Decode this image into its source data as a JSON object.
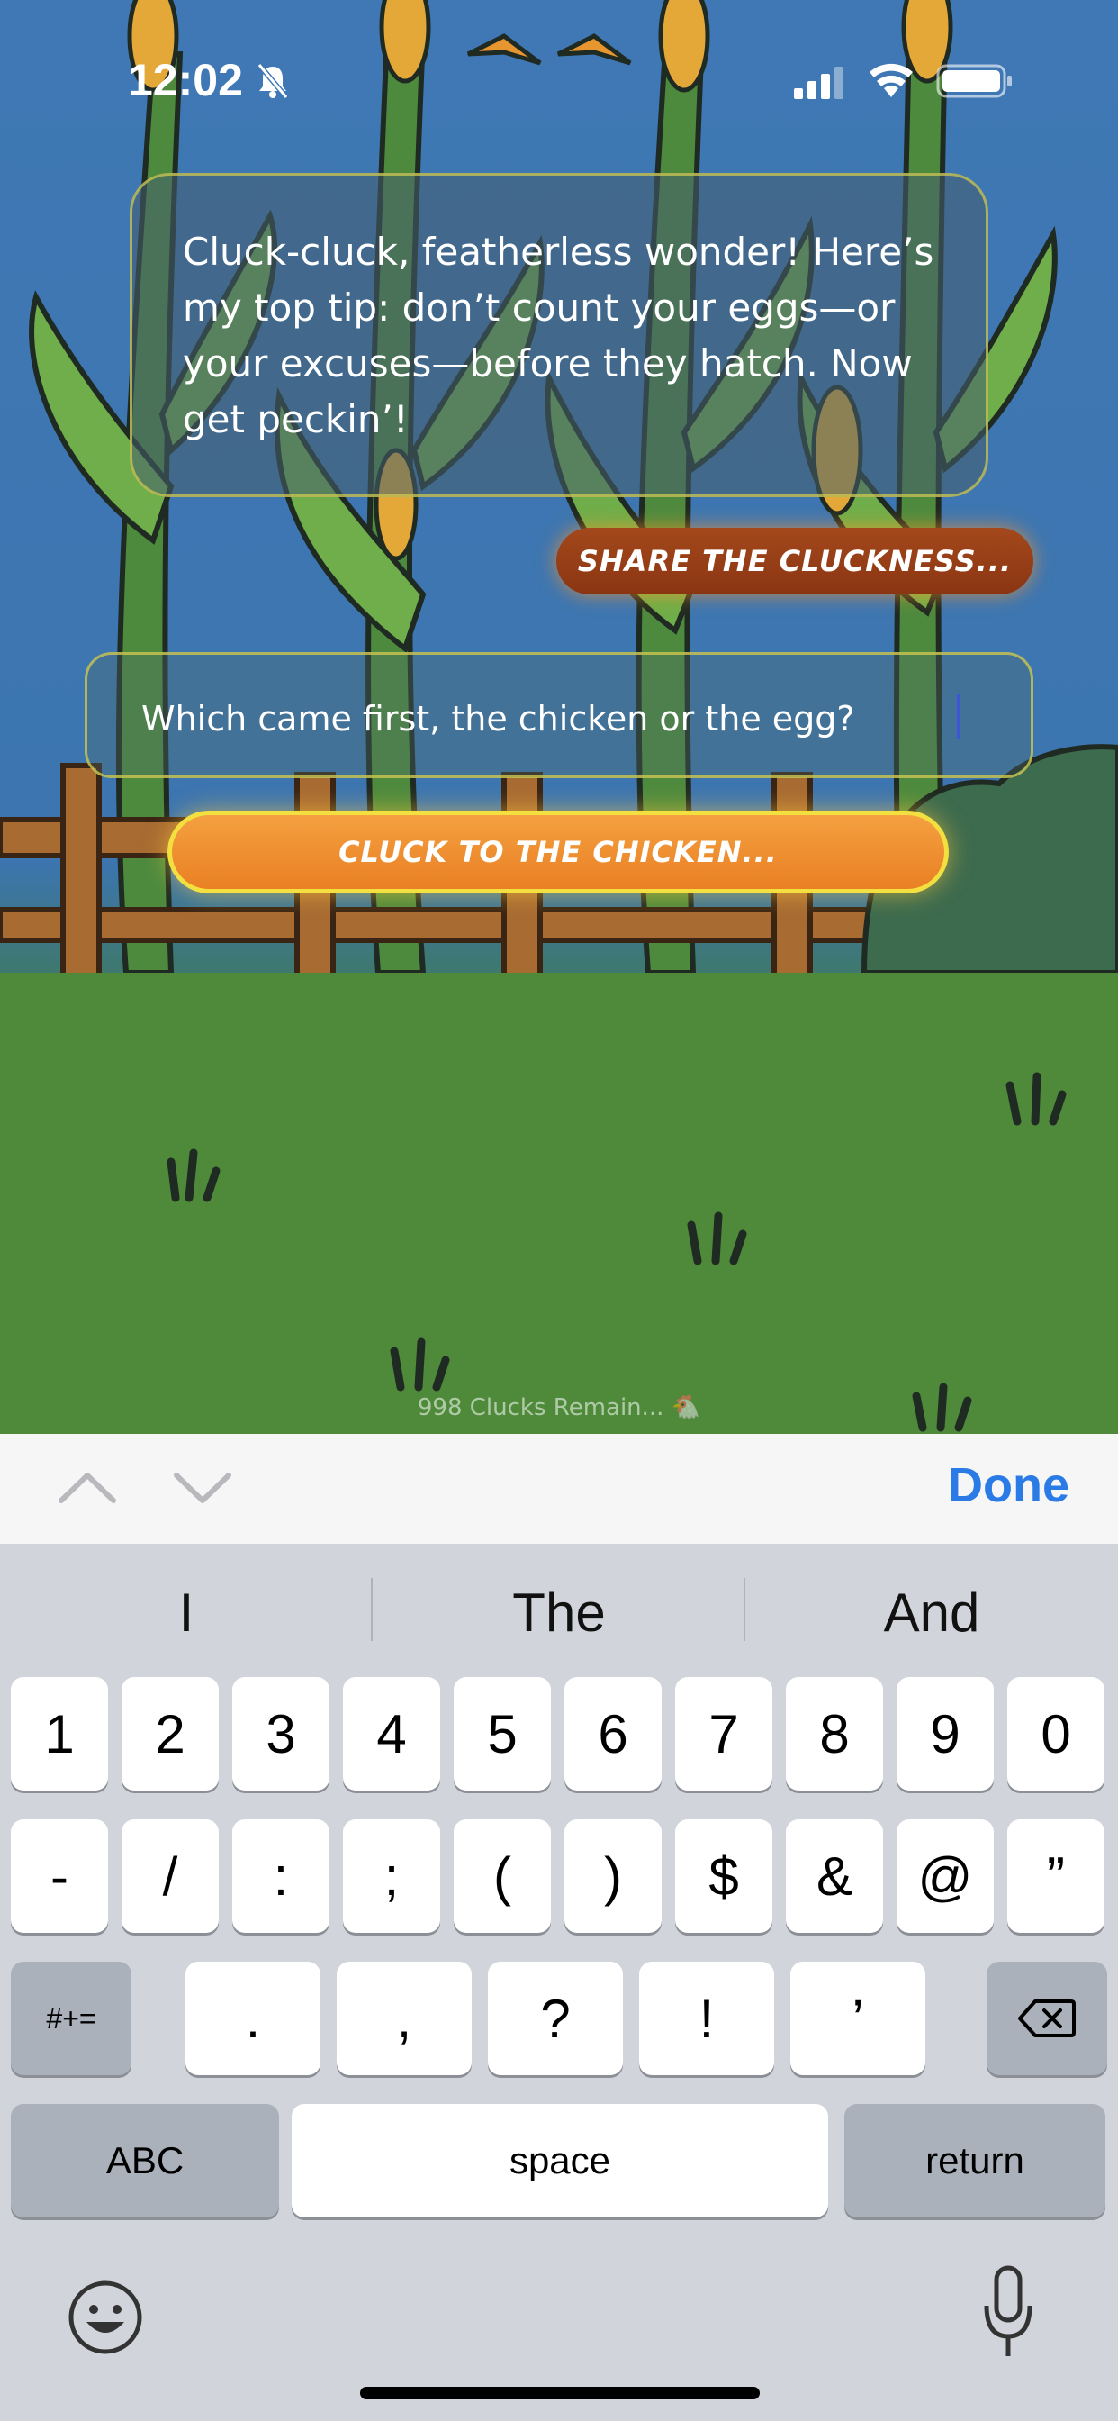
{
  "status_bar": {
    "time": "12:02",
    "icons": [
      "bell-slash-icon",
      "signal-icon",
      "wifi-icon",
      "battery-icon"
    ]
  },
  "chat": {
    "message": "Cluck-cluck, featherless wonder! Here’s my top tip: don’t count your eggs—or your excuses—before they hatch. Now get peckin’!",
    "share_label": "Share the Cluckness..."
  },
  "question_input": {
    "value": "Which came first, the chicken or the egg?"
  },
  "ask_button": {
    "label": "Cluck to the Chicken..."
  },
  "footer": {
    "remaining": "998 Clucks Remain... 🐔"
  },
  "keyboard_toolbar": {
    "done_label": "Done"
  },
  "suggestions": [
    "I",
    "The",
    "And"
  ],
  "keyboard": {
    "row1": [
      "1",
      "2",
      "3",
      "4",
      "5",
      "6",
      "7",
      "8",
      "9",
      "0"
    ],
    "row2": [
      "-",
      "/",
      ":",
      ";",
      "(",
      ")",
      "$",
      "&",
      "@",
      "”"
    ],
    "row3": {
      "shift": "#+=",
      "keys": [
        ".",
        ",",
        "?",
        "!",
        "’"
      ]
    },
    "row4": {
      "abc": "ABC",
      "space": "space",
      "return": "return"
    }
  },
  "colors": {
    "sky": "#3f78b4",
    "grass": "#4a8638",
    "accent_orange": "#e98024",
    "done_blue": "#2b7be6"
  }
}
